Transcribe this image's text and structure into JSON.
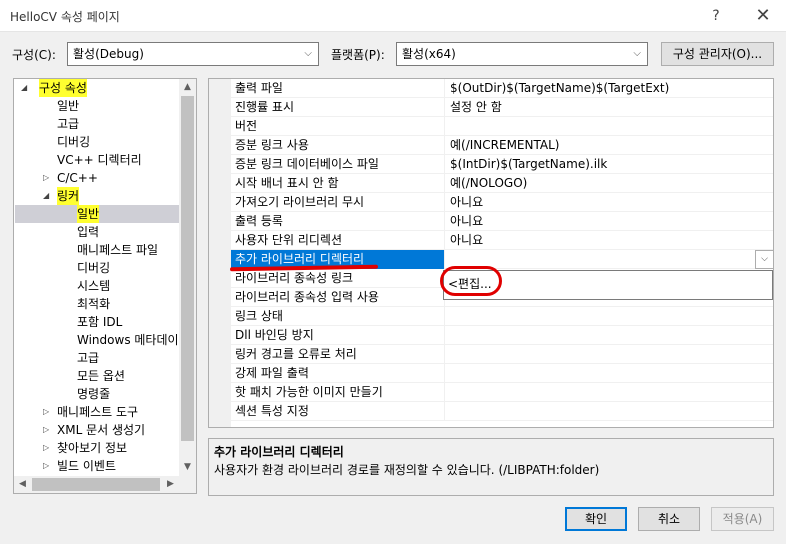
{
  "window": {
    "title": "HelloCV 속성 페이지",
    "help": "?",
    "close": "✕"
  },
  "config_bar": {
    "config_label": "구성(C):",
    "config_value": "활성(Debug)",
    "platform_label": "플랫폼(P):",
    "platform_value": "활성(x64)",
    "manager_button": "구성 관리자(O)..."
  },
  "tree": {
    "root": "구성 속성",
    "items": [
      {
        "label": "일반"
      },
      {
        "label": "고급"
      },
      {
        "label": "디버깅"
      },
      {
        "label": "VC++ 디렉터리"
      },
      {
        "label": "C/C++"
      },
      {
        "label": "링커"
      },
      {
        "label": "일반"
      },
      {
        "label": "입력"
      },
      {
        "label": "매니페스트 파일"
      },
      {
        "label": "디버깅"
      },
      {
        "label": "시스템"
      },
      {
        "label": "최적화"
      },
      {
        "label": "포함 IDL"
      },
      {
        "label": "Windows 메타데이"
      },
      {
        "label": "고급"
      },
      {
        "label": "모든 옵션"
      },
      {
        "label": "명령줄"
      },
      {
        "label": "매니페스트 도구"
      },
      {
        "label": "XML 문서 생성기"
      },
      {
        "label": "찾아보기 정보"
      },
      {
        "label": "빌드 이벤트"
      }
    ],
    "highlight_color": "#ffff30"
  },
  "properties": [
    {
      "name": "출력 파일",
      "value": "$(OutDir)$(TargetName)$(TargetExt)"
    },
    {
      "name": "진행률 표시",
      "value": "설정 안 함"
    },
    {
      "name": "버전",
      "value": ""
    },
    {
      "name": "증분 링크 사용",
      "value": "예(/INCREMENTAL)"
    },
    {
      "name": "증분 링크 데이터베이스 파일",
      "value": "$(IntDir)$(TargetName).ilk"
    },
    {
      "name": "시작 배너 표시 안 함",
      "value": "예(/NOLOGO)"
    },
    {
      "name": "가져오기 라이브러리 무시",
      "value": "아니요"
    },
    {
      "name": "출력 등록",
      "value": "아니요"
    },
    {
      "name": "사용자 단위 리디렉션",
      "value": "아니요"
    },
    {
      "name": "추가 라이브러리 디렉터리",
      "value": ""
    },
    {
      "name": "라이브러리 종속성 링크",
      "value": ""
    },
    {
      "name": "라이브러리 종속성 입력 사용",
      "value": ""
    },
    {
      "name": "링크 상태",
      "value": ""
    },
    {
      "name": "Dll 바인딩 방지",
      "value": ""
    },
    {
      "name": "링커 경고를 오류로 처리",
      "value": ""
    },
    {
      "name": "강제 파일 출력",
      "value": ""
    },
    {
      "name": "핫 패치 가능한 이미지 만들기",
      "value": ""
    },
    {
      "name": "섹션 특성 지정",
      "value": ""
    }
  ],
  "dropdown": {
    "edit_item": "<편집..."
  },
  "description": {
    "title": "추가 라이브러리 디렉터리",
    "text": "사용자가 환경 라이브러리 경로를 재정의할 수 있습니다. (/LIBPATH:folder)"
  },
  "buttons": {
    "ok": "확인",
    "cancel": "취소",
    "apply": "적용(A)"
  },
  "colors": {
    "selection": "#0078d7",
    "annotation": "#e00000"
  }
}
